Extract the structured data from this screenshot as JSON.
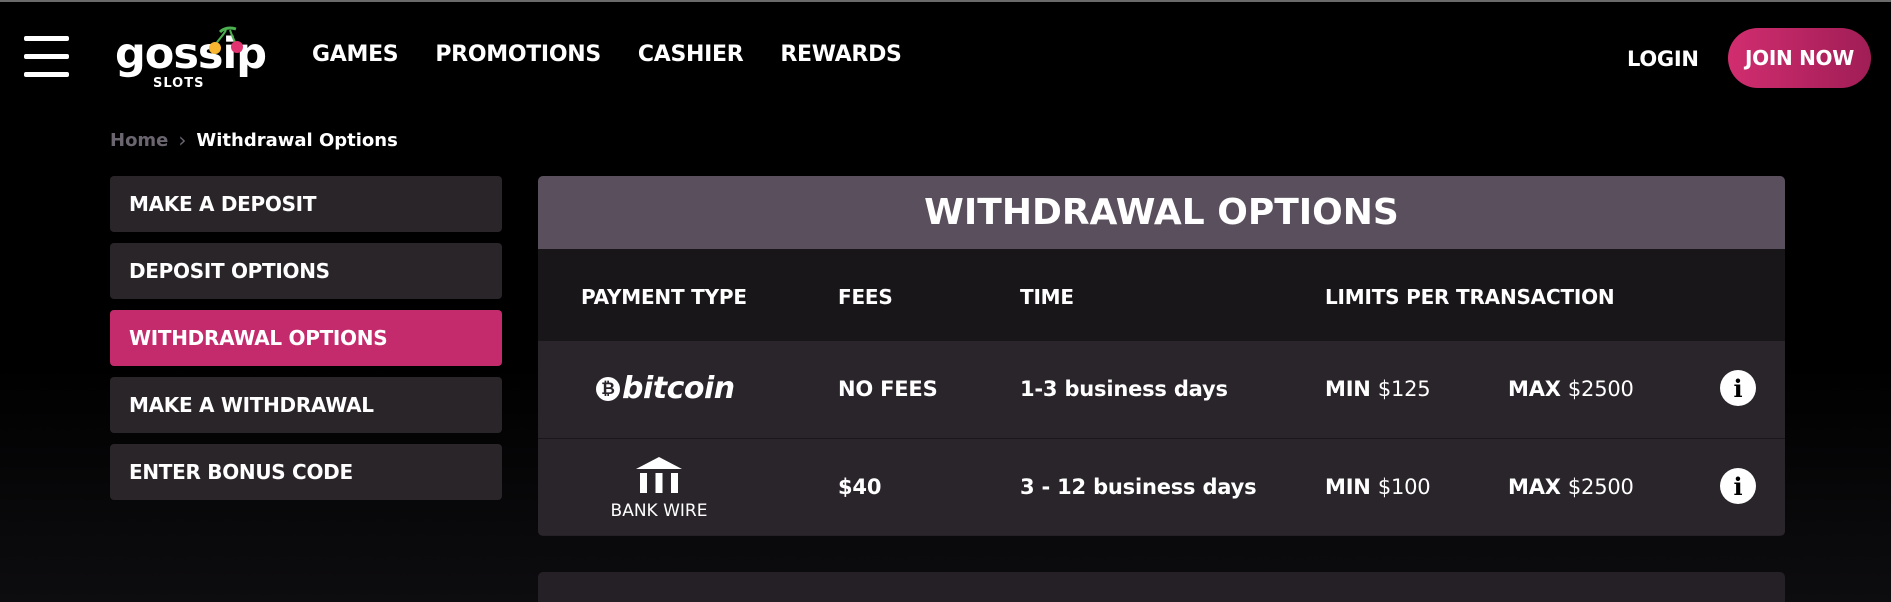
{
  "header": {
    "logo": {
      "word": "gossip",
      "sub": "SLOTS"
    },
    "nav": [
      "GAMES",
      "PROMOTIONS",
      "CASHIER",
      "REWARDS"
    ],
    "login_label": "LOGIN",
    "join_label": "JOIN NOW"
  },
  "breadcrumb": {
    "home": "Home",
    "current": "Withdrawal Options"
  },
  "sidebar": {
    "items": [
      {
        "label": "MAKE A DEPOSIT"
      },
      {
        "label": "DEPOSIT OPTIONS"
      },
      {
        "label": "WITHDRAWAL OPTIONS",
        "active": true
      },
      {
        "label": "MAKE A WITHDRAWAL"
      },
      {
        "label": "ENTER BONUS CODE"
      }
    ]
  },
  "main": {
    "title": "WITHDRAWAL OPTIONS",
    "columns": [
      "PAYMENT TYPE",
      "FEES",
      "TIME",
      "LIMITS PER TRANSACTION"
    ],
    "rows": [
      {
        "payment": "bitcoin",
        "payment_icon": "bitcoin-logo-icon",
        "fees": "NO FEES",
        "time": "1-3 business days",
        "min_label": "MIN",
        "min_value": "$125",
        "max_label": "MAX",
        "max_value": "$2500"
      },
      {
        "payment": "BANK WIRE",
        "payment_icon": "bank-icon",
        "fees": "$40",
        "time": "3 - 12 business days",
        "min_label": "MIN",
        "min_value": "$100",
        "max_label": "MAX",
        "max_value": "$2500"
      }
    ],
    "info_glyph": "i"
  },
  "colors": {
    "accent": "#c42b6c",
    "panel_title_bg": "#5a505d",
    "sidebar_item_bg": "#2a2529"
  }
}
